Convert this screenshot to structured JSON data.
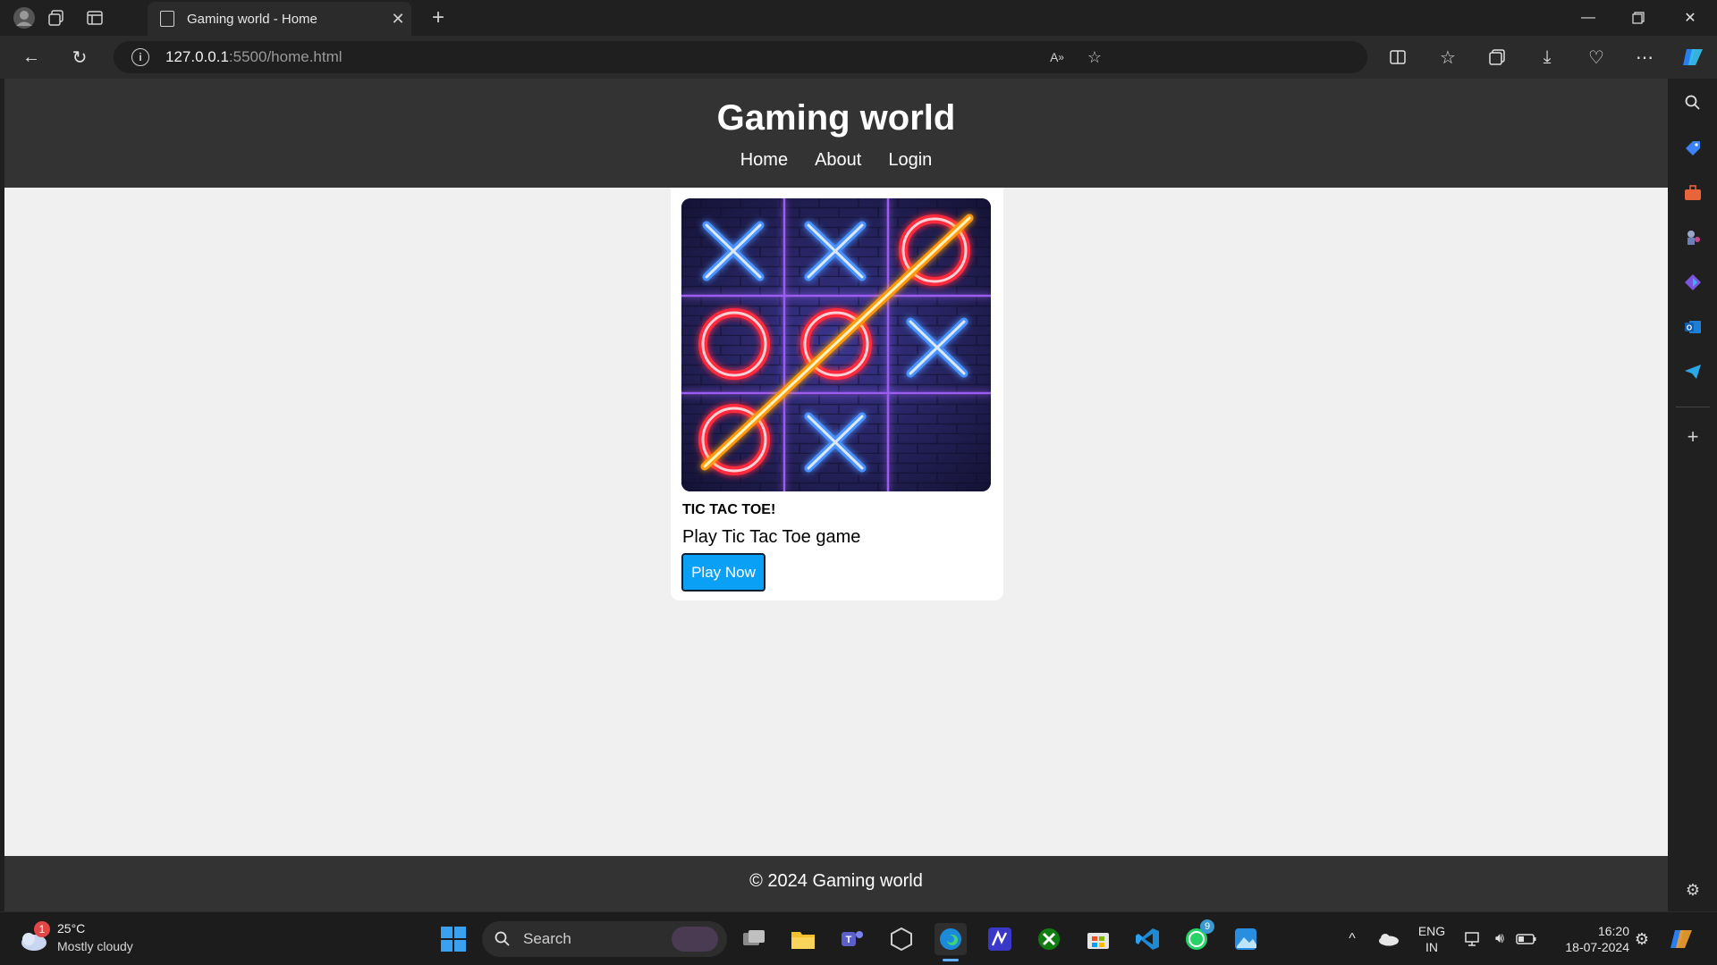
{
  "browser": {
    "tab_title": "Gaming world - Home",
    "url_host": "127.0.0.1",
    "url_rest": ":5500/home.html"
  },
  "site": {
    "title": "Gaming world",
    "nav": [
      "Home",
      "About",
      "Login"
    ],
    "card": {
      "heading": "TIC TAC TOE!",
      "description": "Play Tic Tac Toe game",
      "button": "Play Now"
    },
    "footer": "© 2024 Gaming world"
  },
  "taskbar": {
    "weather_temp": "25°C",
    "weather_desc": "Mostly cloudy",
    "weather_badge": "1",
    "search_label": "Search",
    "whatsapp_badge": "9",
    "lang_line1": "ENG",
    "lang_line2": "IN",
    "time": "16:20",
    "date": "18-07-2024"
  },
  "colors": {
    "header_bg": "#333333",
    "page_bg": "#f0f0f0",
    "button_bg": "#0aa0f5",
    "neon_x": "#3a8bff",
    "neon_o": "#ff3040",
    "neon_line": "#ffb020"
  }
}
